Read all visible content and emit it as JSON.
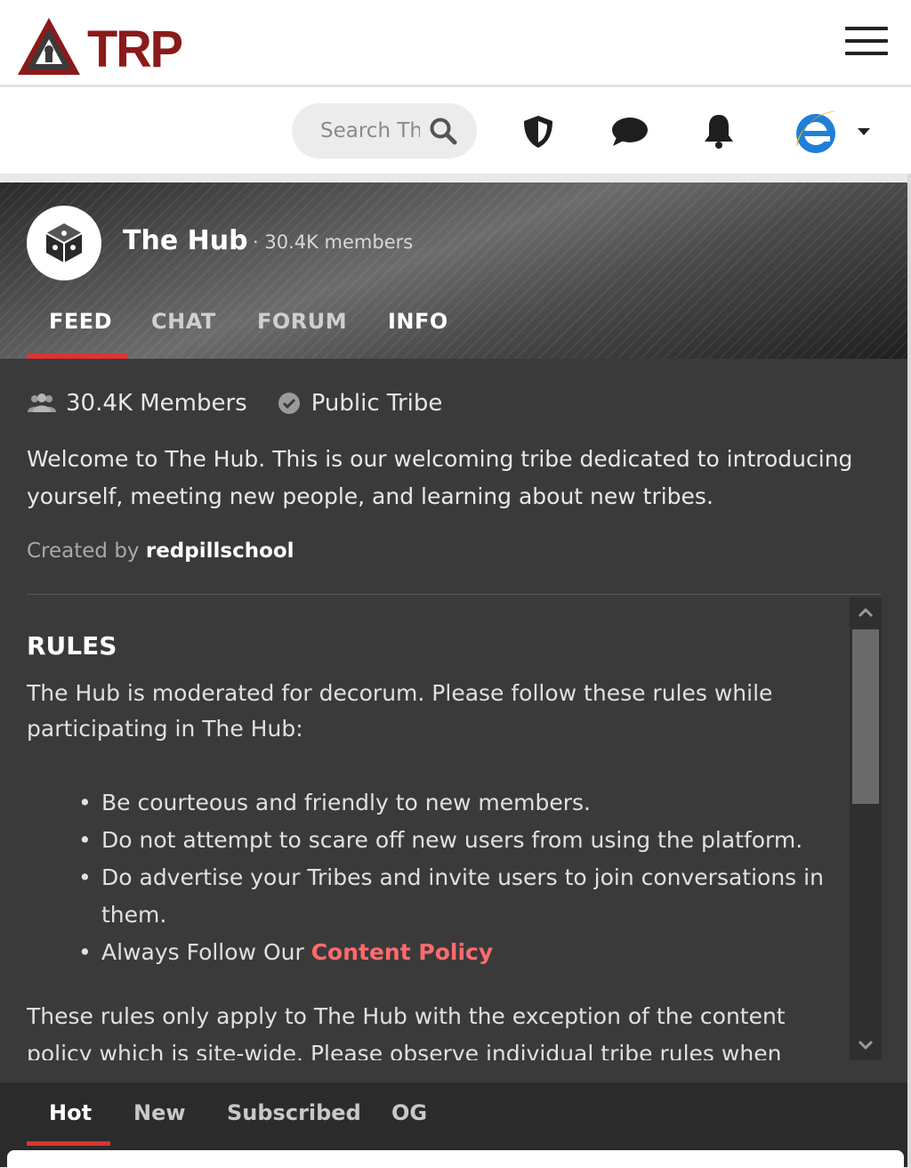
{
  "site": {
    "logo_text": "TRP"
  },
  "search": {
    "placeholder": "Search The Hub"
  },
  "tribe": {
    "name": "The Hub",
    "members_short": "· 30.4K members",
    "tabs": [
      {
        "label": "FEED",
        "active": true
      },
      {
        "label": "CHAT",
        "active": false
      },
      {
        "label": "FORUM",
        "active": false
      },
      {
        "label": "INFO",
        "active": false
      }
    ]
  },
  "info": {
    "members": "30.4K Members",
    "visibility": "Public Tribe",
    "description": "Welcome to The Hub. This is our welcoming tribe dedicated to introducing yourself, meeting new people, and learning about new tribes.",
    "created_prefix": "Created by",
    "creator": "redpillschool"
  },
  "rules": {
    "title": "RULES",
    "intro": "The Hub is moderated for decorum. Please follow these rules while participating in The Hub:",
    "items": [
      "Be courteous and friendly to new members.",
      "Do not attempt to scare off new users from using the platform.",
      "Do advertise your Tribes and invite users to join conversations in them."
    ],
    "last_item_prefix": "Always Follow Our",
    "policy_link": "Content Policy",
    "footer": "These rules only apply to The Hub with the exception of the content policy which is site-wide. Please observe individual tribe rules when"
  },
  "sort_tabs": [
    {
      "label": "Hot",
      "active": true
    },
    {
      "label": "New",
      "active": false
    },
    {
      "label": "Subscribed",
      "active": false
    },
    {
      "label": "OG",
      "active": false
    }
  ],
  "colors": {
    "accent": "#dd3333",
    "link": "#ff6b6b",
    "brand": "#8b1a1a",
    "panel": "#3a3a3b"
  },
  "icons": {
    "shield": "shield-icon",
    "chat": "chat-bubble-icon",
    "bell": "bell-icon",
    "browser": "ie-browser-icon"
  }
}
